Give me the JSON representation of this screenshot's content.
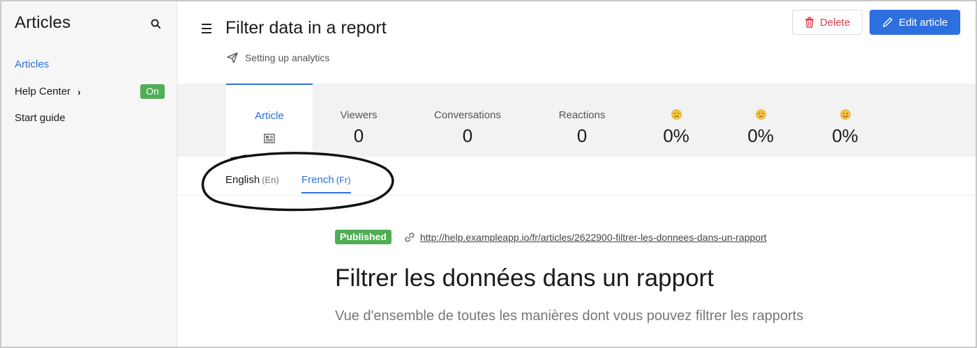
{
  "sidebar": {
    "title": "Articles",
    "items": [
      {
        "label": "Articles"
      },
      {
        "label": "Help Center"
      },
      {
        "label": "Start guide"
      }
    ],
    "help_center_badge": "On"
  },
  "header": {
    "title": "Filter data in a report",
    "collection": "Setting up analytics",
    "delete_label": "Delete",
    "edit_label": "Edit article"
  },
  "stats": {
    "article_label": "Article",
    "viewers_label": "Viewers",
    "viewers_value": "0",
    "conversations_label": "Conversations",
    "conversations_value": "0",
    "reactions_label": "Reactions",
    "reactions_value": "0",
    "sad_value": "0%",
    "neutral_value": "0%",
    "happy_value": "0%"
  },
  "languages": [
    {
      "name": "English",
      "code": "(En)"
    },
    {
      "name": "French",
      "code": "(Fr)"
    }
  ],
  "article": {
    "status": "Published",
    "url": "http://help.exampleapp.io/fr/articles/2622900-filtrer-les-donnees-dans-un-rapport",
    "title": "Filtrer les données dans un rapport",
    "description": "Vue d'ensemble de toutes les manières dont vous pouvez filtrer les rapports"
  },
  "colors": {
    "accent": "#2e6fe0",
    "success": "#4fae55",
    "danger": "#d9404f"
  }
}
